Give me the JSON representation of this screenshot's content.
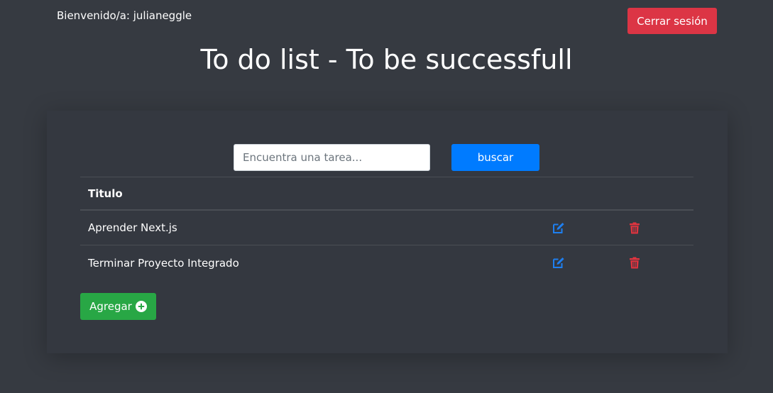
{
  "header": {
    "welcome_text": "Bienvenido/a: julianeggle",
    "logout_label": "Cerrar sesión"
  },
  "page_title": "To do list - To be successfull",
  "search": {
    "placeholder": "Encuentra una tarea...",
    "value": "",
    "button_label": "buscar"
  },
  "table": {
    "header_title": "Titulo",
    "rows": [
      {
        "title": "Aprender Next.js",
        "edit_icon": "edit-icon",
        "delete_icon": "trash-icon"
      },
      {
        "title": "Terminar Proyecto Integrado",
        "edit_icon": "edit-icon",
        "delete_icon": "trash-icon"
      }
    ]
  },
  "add_button": {
    "label": "Agregar",
    "icon": "plus-circle-icon"
  },
  "colors": {
    "background": "#363a41",
    "card": "#343840",
    "danger": "#dc3545",
    "primary": "#007bff",
    "success": "#28a745",
    "edit_icon": "#1e7ff0",
    "delete_icon": "#e0343f"
  }
}
